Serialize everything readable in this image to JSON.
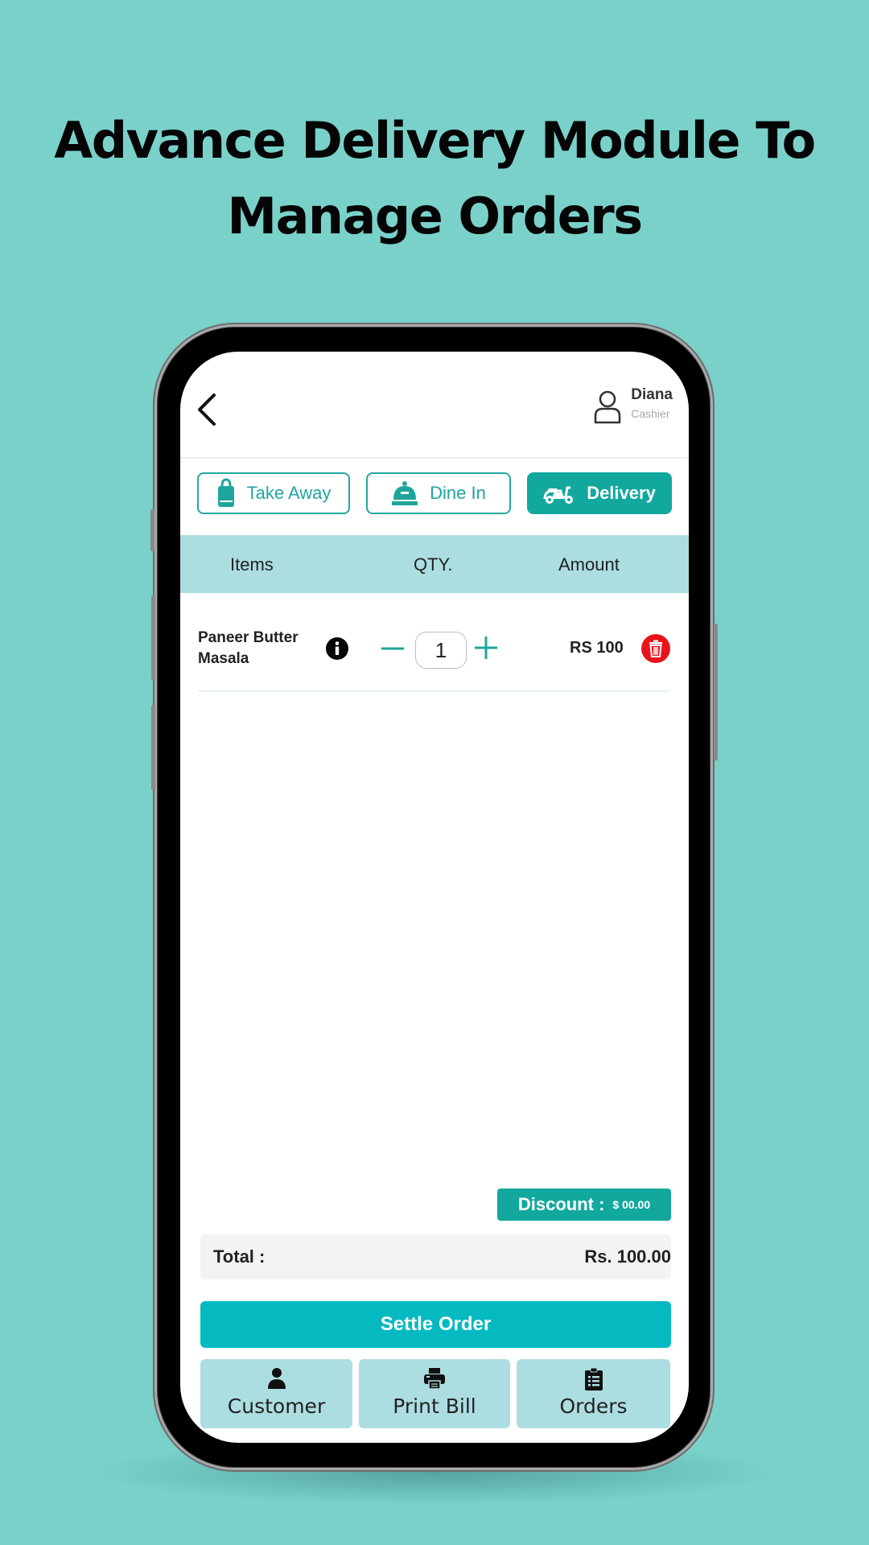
{
  "headline": {
    "line1": "Advance Delivery Module To",
    "line2": "Manage Orders"
  },
  "header": {
    "user_name": "Diana",
    "user_role": "Cashier"
  },
  "order_modes": [
    {
      "label": "Take Away",
      "icon": "shopping-bag-icon",
      "active": false
    },
    {
      "label": "Dine In",
      "icon": "food-cloche-icon",
      "active": false
    },
    {
      "label": "Delivery",
      "icon": "scooter-icon",
      "active": true
    }
  ],
  "table": {
    "columns": [
      "Items",
      "QTY.",
      "Amount"
    ],
    "rows": [
      {
        "item": "Paneer Butter Masala",
        "qty": "1",
        "amount": "RS 100"
      }
    ]
  },
  "discount": {
    "label": "Discount :",
    "value": "$ 00.00"
  },
  "total": {
    "label": "Total :",
    "value": "Rs. 100.00"
  },
  "actions": {
    "settle": "Settle Order",
    "customer": "Customer",
    "print_bill": "Print Bill",
    "orders": "Orders"
  },
  "colors": {
    "background": "#79d1ca",
    "accent": "#12a89e",
    "settle": "#05b9c0",
    "table_header": "#acdde1",
    "delete": "#e8141b"
  }
}
